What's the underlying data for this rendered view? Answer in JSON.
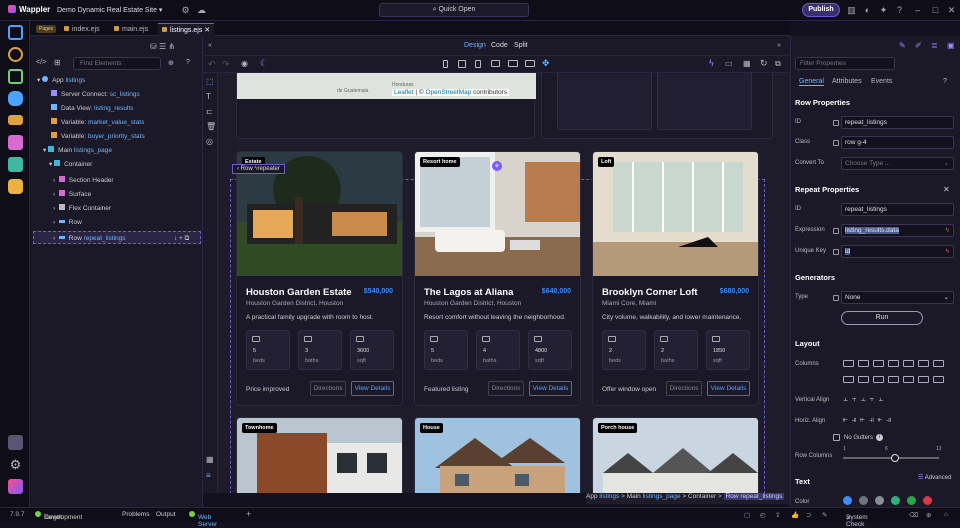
{
  "titlebar": {
    "app": "Wappler",
    "project": "Demo Dynamic Real Estate Site",
    "quick_open": "Quick Open",
    "publish": "Publish"
  },
  "tabs": {
    "pages_badge": "Pages",
    "items": [
      "index.ejs",
      "main.ejs",
      "listings.ejs"
    ]
  },
  "view_modes": [
    "Design",
    "Code",
    "Split"
  ],
  "left": {
    "find_placeholder": "Find Elements",
    "tree": [
      {
        "label": "App",
        "name": "listings"
      },
      {
        "label": "Server Connect:",
        "name": "sc_listings"
      },
      {
        "label": "Data View:",
        "name": "listing_results"
      },
      {
        "label": "Variable:",
        "name": "market_value_stats"
      },
      {
        "label": "Variable:",
        "name": "buyer_priority_stats"
      },
      {
        "label": "Main",
        "name": "listings_page"
      },
      {
        "label": "Container",
        "name": ""
      },
      {
        "label": "Section Header",
        "name": ""
      },
      {
        "label": "Surface",
        "name": ""
      },
      {
        "label": "Flex Container",
        "name": ""
      },
      {
        "label": "Row",
        "name": ""
      },
      {
        "label": "Row",
        "name": "repeat_listings"
      }
    ]
  },
  "canvas": {
    "map_attribution": {
      "leaflet": "Leaflet",
      "sep": " | © ",
      "osm": "OpenStreetMap",
      "tail": " contributors"
    },
    "map_labels": {
      "a": "Honduras",
      "b": "de Guatemala"
    },
    "row_hint": "Row",
    "row_hint_sub": "repeater",
    "stat_labels": {
      "beds": "beds",
      "baths": "baths",
      "sqft": "sqft"
    },
    "directions": "Directions",
    "view_details": "View Details",
    "cards": [
      {
        "badge": "Estate",
        "title": "Houston Garden Estate",
        "price": "$540,000",
        "loc": "Houston Garden District, Houston",
        "desc": "A practical family upgrade with room to host.",
        "beds": "5",
        "baths": "3",
        "sqft": "3600",
        "note": "Price improved"
      },
      {
        "badge": "Resort home",
        "title": "The Lagos at Aliana",
        "price": "$640,000",
        "loc": "Houston Garden District, Houston",
        "desc": "Resort comfort without leaving the neighborhood.",
        "beds": "5",
        "baths": "4",
        "sqft": "4800",
        "note": "Featured listing"
      },
      {
        "badge": "Loft",
        "title": "Brooklyn Corner Loft",
        "price": "$680,000",
        "loc": "Miami Core, Miami",
        "desc": "City volume, walkability, and lower maintenance.",
        "beds": "2",
        "baths": "2",
        "sqft": "1850",
        "note": "Offer window open"
      },
      {
        "badge": "Townhome"
      },
      {
        "badge": "House"
      },
      {
        "badge": "Porch house"
      }
    ]
  },
  "breadcrumb": {
    "app": "App",
    "app_name": "listings",
    "main": "Main",
    "main_name": "listings_page",
    "container": "Container",
    "row": "Row",
    "row_name": "repeat_listings"
  },
  "right": {
    "filter_placeholder": "Filter Properties",
    "tabs": [
      "General",
      "Attributes",
      "Events"
    ],
    "row_props_title": "Row Properties",
    "id_label": "ID",
    "id_value": "repeat_listings",
    "class_label": "Class",
    "class_value": "row g-4",
    "convert_label": "Convert To",
    "convert_placeholder": "Choose Type ...",
    "repeat_title": "Repeat Properties",
    "rid_label": "ID",
    "rid_value": "repeat_listings",
    "expr_label": "Expression",
    "expr_value": "listing_results.data",
    "key_label": "Unique Key",
    "key_value": "id",
    "gen_title": "Generators",
    "type_label": "Type",
    "type_value": "None",
    "run": "Run",
    "layout_title": "Layout",
    "columns_label": "Columns",
    "valign_label": "Vertical Align",
    "halign_label": "Horiz. Align",
    "gutters_label": "No Gutters",
    "rowcols_label": "Row Columns",
    "rowcols_ticks": [
      "1",
      "6",
      "12"
    ],
    "rowcols_value": 6,
    "text_title": "Text",
    "advanced": "Advanced",
    "color_label": "Color",
    "swatches": [
      "#3d8bff",
      "#6c757d",
      "#8a8f96",
      "#2fb07a",
      "#28a745",
      "#dc3545"
    ]
  },
  "status": {
    "version": "7.9.7",
    "target_label": "Target:",
    "target": "Development",
    "problems": "Problems",
    "output": "Output",
    "web_server": "Web Server",
    "system_check": "System Check"
  }
}
